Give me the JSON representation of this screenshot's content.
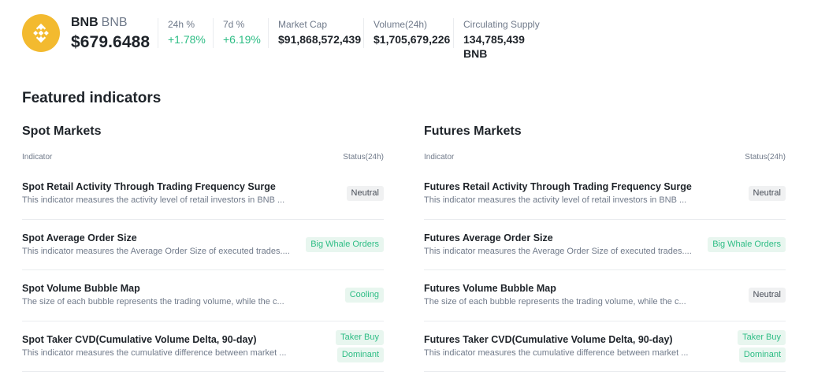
{
  "coin": {
    "symbol": "BNB",
    "pair": "BNB",
    "price": "$679.6488"
  },
  "stats": [
    {
      "label": "24h %",
      "value": "+1.78%"
    },
    {
      "label": "7d %",
      "value": "+6.19%"
    },
    {
      "label": "Market Cap",
      "value": "$91,868,572,439"
    },
    {
      "label": "Volume(24h)",
      "value": "$1,705,679,226"
    },
    {
      "label": "Circulating Supply",
      "value": "134,785,439 BNB"
    }
  ],
  "featured_title": "Featured indicators",
  "spot": {
    "title": "Spot Markets",
    "head_indicator": "Indicator",
    "head_status": "Status(24h)",
    "rows": [
      {
        "title": "Spot Retail Activity Through Trading Frequency Surge",
        "desc": "This indicator measures the activity level of retail investors in BNB ...",
        "status": "Neutral"
      },
      {
        "title": "Spot Average Order Size",
        "desc": "This indicator measures the Average Order Size of executed trades....",
        "status": "Big Whale Orders"
      },
      {
        "title": "Spot Volume Bubble Map",
        "desc": "The size of each bubble represents the trading volume, while the c...",
        "status": "Cooling"
      },
      {
        "title": "Spot Taker CVD(Cumulative Volume Delta, 90-day)",
        "desc": "This indicator measures the cumulative difference between market ...",
        "status1": "Taker Buy",
        "status2": "Dominant"
      }
    ]
  },
  "futures": {
    "title": "Futures Markets",
    "head_indicator": "Indicator",
    "head_status": "Status(24h)",
    "rows": [
      {
        "title": "Futures Retail Activity Through Trading Frequency Surge",
        "desc": "This indicator measures the activity level of retail investors in BNB ...",
        "status": "Neutral"
      },
      {
        "title": "Futures Average Order Size",
        "desc": "This indicator measures the Average Order Size of executed trades....",
        "status": "Big Whale Orders"
      },
      {
        "title": "Futures Volume Bubble Map",
        "desc": "The size of each bubble represents the trading volume, while the c...",
        "status": "Neutral"
      },
      {
        "title": "Futures Taker CVD(Cumulative Volume Delta, 90-day)",
        "desc": "This indicator measures the cumulative difference between market ...",
        "status1": "Taker Buy",
        "status2": "Dominant"
      }
    ]
  },
  "colors": {
    "brand": "#f3ba2f",
    "positive": "#2ebd85",
    "neutral_badge": "#f0f1f2",
    "green_badge": "#e8f6ef"
  },
  "icons": {
    "logo": "bnb-logo-icon"
  }
}
